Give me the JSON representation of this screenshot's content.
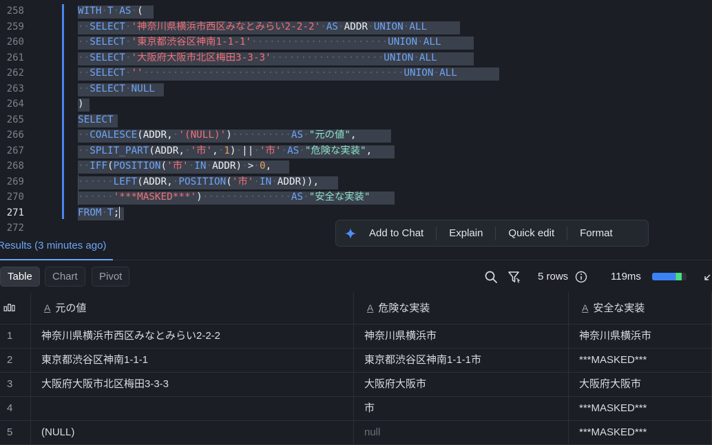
{
  "editor": {
    "lines": [
      {
        "n": "258",
        "active": false,
        "tokens": [
          [
            "kw",
            "WITH"
          ],
          [
            "dot",
            "·"
          ],
          [
            "kw",
            "T"
          ],
          [
            "dot",
            "·"
          ],
          [
            "kw",
            "AS"
          ],
          [
            "dot",
            "·"
          ],
          [
            "id",
            "("
          ]
        ]
      },
      {
        "n": "259",
        "active": false,
        "tokens": [
          [
            "dot",
            "··"
          ],
          [
            "kw",
            "SELECT"
          ],
          [
            "dot",
            "·"
          ],
          [
            "str",
            "'神奈川県横浜市西区みなとみらい2-2-2'"
          ],
          [
            "dot",
            "·"
          ],
          [
            "kw",
            "AS"
          ],
          [
            "dot",
            "·"
          ],
          [
            "id",
            "ADDR"
          ],
          [
            "dot",
            "·"
          ],
          [
            "kw",
            "UNION"
          ],
          [
            "dot",
            "·"
          ],
          [
            "kw",
            "ALL"
          ]
        ]
      },
      {
        "n": "260",
        "active": false,
        "tokens": [
          [
            "dot",
            "··"
          ],
          [
            "kw",
            "SELECT"
          ],
          [
            "dot",
            "·"
          ],
          [
            "str",
            "'東京都渋谷区神南1-1-1'"
          ],
          [
            "dot",
            "·······················"
          ],
          [
            "kw",
            "UNION"
          ],
          [
            "dot",
            "·"
          ],
          [
            "kw",
            "ALL"
          ]
        ]
      },
      {
        "n": "261",
        "active": false,
        "tokens": [
          [
            "dot",
            "··"
          ],
          [
            "kw",
            "SELECT"
          ],
          [
            "dot",
            "·"
          ],
          [
            "str",
            "'大阪府大阪市北区梅田3-3-3'"
          ],
          [
            "dot",
            "···················"
          ],
          [
            "kw",
            "UNION"
          ],
          [
            "dot",
            "·"
          ],
          [
            "kw",
            "ALL"
          ]
        ]
      },
      {
        "n": "262",
        "active": false,
        "tokens": [
          [
            "dot",
            "··"
          ],
          [
            "kw",
            "SELECT"
          ],
          [
            "dot",
            "·"
          ],
          [
            "str",
            "''"
          ],
          [
            "dot",
            "············································"
          ],
          [
            "kw",
            "UNION"
          ],
          [
            "dot",
            "·"
          ],
          [
            "kw",
            "ALL"
          ]
        ]
      },
      {
        "n": "263",
        "active": false,
        "tokens": [
          [
            "dot",
            "··"
          ],
          [
            "kw",
            "SELECT"
          ],
          [
            "dot",
            "·"
          ],
          [
            "kw",
            "NULL"
          ]
        ]
      },
      {
        "n": "264",
        "active": false,
        "tokens": [
          [
            "id",
            ")"
          ]
        ]
      },
      {
        "n": "265",
        "active": false,
        "tokens": [
          [
            "kw",
            "SELECT"
          ]
        ]
      },
      {
        "n": "266",
        "active": false,
        "tokens": [
          [
            "dot",
            "··"
          ],
          [
            "fn",
            "COALESCE"
          ],
          [
            "id",
            "(ADDR,"
          ],
          [
            "dot",
            "·"
          ],
          [
            "str",
            "'(NULL)'"
          ],
          [
            "id",
            ")"
          ],
          [
            "dot",
            "··········"
          ],
          [
            "kw",
            "AS"
          ],
          [
            "dot",
            "·"
          ],
          [
            "alias",
            "\"元の値\""
          ],
          [
            "id",
            ","
          ]
        ]
      },
      {
        "n": "267",
        "active": false,
        "tokens": [
          [
            "dot",
            "··"
          ],
          [
            "fn",
            "SPLIT_PART"
          ],
          [
            "id",
            "(ADDR,"
          ],
          [
            "dot",
            "·"
          ],
          [
            "str",
            "'市'"
          ],
          [
            "id",
            ","
          ],
          [
            "dot",
            "·"
          ],
          [
            "num",
            "1"
          ],
          [
            "id",
            ")"
          ],
          [
            "dot",
            "·"
          ],
          [
            "id",
            "||"
          ],
          [
            "dot",
            "·"
          ],
          [
            "str",
            "'市'"
          ],
          [
            "dot",
            "·"
          ],
          [
            "kw",
            "AS"
          ],
          [
            "dot",
            "·"
          ],
          [
            "alias",
            "\"危険な実装\""
          ],
          [
            "id",
            ","
          ]
        ]
      },
      {
        "n": "268",
        "active": false,
        "tokens": [
          [
            "dot",
            "··"
          ],
          [
            "fn",
            "IFF"
          ],
          [
            "id",
            "("
          ],
          [
            "fn",
            "POSITION"
          ],
          [
            "id",
            "("
          ],
          [
            "str",
            "'市'"
          ],
          [
            "dot",
            "·"
          ],
          [
            "kw",
            "IN"
          ],
          [
            "dot",
            "·"
          ],
          [
            "id",
            "ADDR)"
          ],
          [
            "dot",
            "·"
          ],
          [
            "id",
            ">"
          ],
          [
            "dot",
            "·"
          ],
          [
            "num",
            "0"
          ],
          [
            "id",
            ","
          ]
        ]
      },
      {
        "n": "269",
        "active": false,
        "tokens": [
          [
            "dot",
            "······"
          ],
          [
            "fn",
            "LEFT"
          ],
          [
            "id",
            "(ADDR,"
          ],
          [
            "dot",
            "·"
          ],
          [
            "fn",
            "POSITION"
          ],
          [
            "id",
            "("
          ],
          [
            "str",
            "'市'"
          ],
          [
            "dot",
            "·"
          ],
          [
            "kw",
            "IN"
          ],
          [
            "dot",
            "·"
          ],
          [
            "id",
            "ADDR)),"
          ]
        ]
      },
      {
        "n": "270",
        "active": false,
        "tokens": [
          [
            "dot",
            "······"
          ],
          [
            "str",
            "'***MASKED***'"
          ],
          [
            "id",
            ")"
          ],
          [
            "dot",
            "···············"
          ],
          [
            "kw",
            "AS"
          ],
          [
            "dot",
            "·"
          ],
          [
            "alias",
            "\"安全な実装\""
          ]
        ]
      },
      {
        "n": "271",
        "active": true,
        "tokens": [
          [
            "kw",
            "FROM"
          ],
          [
            "dot",
            "·"
          ],
          [
            "kw",
            "T"
          ],
          [
            "id",
            ";"
          ]
        ]
      },
      {
        "n": "272",
        "active": false,
        "tokens": []
      }
    ]
  },
  "floating_toolbar": {
    "icon": "sparkle-icon",
    "add_to_chat": "Add to Chat",
    "explain": "Explain",
    "quick_edit": "Quick edit",
    "format": "Format"
  },
  "results": {
    "tab_label": "Results (3 minutes ago)",
    "views": [
      "Table",
      "Chart",
      "Pivot"
    ],
    "active_view": "Table",
    "rows_label": "5 rows",
    "duration_label": "119ms",
    "timing_fraction": 0.85,
    "timing_colors": {
      "primary": "#3b82f6",
      "secondary": "#4ade80"
    },
    "columns": [
      "元の値",
      "危険な実装",
      "安全な実装"
    ],
    "column_type_glyph": "A",
    "rows": [
      {
        "idx": "1",
        "cells": [
          "神奈川県横浜市西区みなとみらい2-2-2",
          "神奈川県横浜市",
          "神奈川県横浜市"
        ]
      },
      {
        "idx": "2",
        "cells": [
          "東京都渋谷区神南1-1-1",
          "東京都渋谷区神南1-1-1市",
          "***MASKED***"
        ]
      },
      {
        "idx": "3",
        "cells": [
          "大阪府大阪市北区梅田3-3-3",
          "大阪府大阪市",
          "大阪府大阪市"
        ]
      },
      {
        "idx": "4",
        "cells": [
          "",
          "市",
          "***MASKED***"
        ]
      },
      {
        "idx": "5",
        "cells": [
          "(NULL)",
          "null",
          "***MASKED***"
        ]
      }
    ]
  },
  "colors": {
    "accent": "#6ea5f7",
    "keyword": "#6ea5f7",
    "string": "#f07178",
    "alias": "#8fe0c9",
    "number": "#e4a35f"
  }
}
